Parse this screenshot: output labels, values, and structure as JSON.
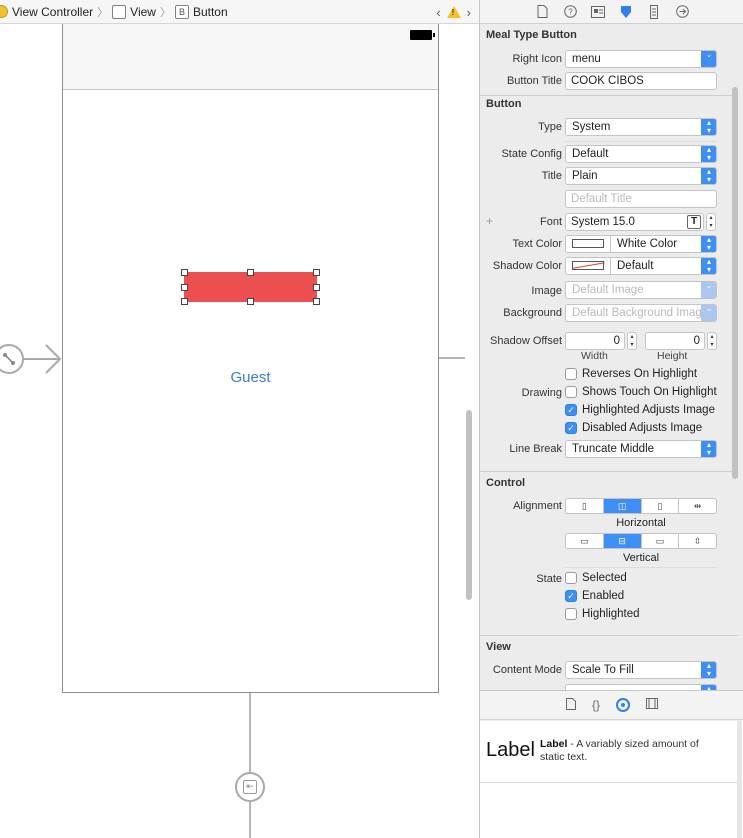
{
  "jumpbar": {
    "items": [
      "View Controller",
      "View",
      "Button"
    ],
    "view_icon": "view-square-icon",
    "button_icon_glyph": "B"
  },
  "canvas": {
    "guest_label": "Guest"
  },
  "inspector": {
    "tabs": [
      "file-icon",
      "help-icon",
      "identity-icon",
      "attributes-icon",
      "size-icon",
      "connections-icon"
    ],
    "active_tab": "attributes-icon",
    "meal_section": {
      "title": "Meal Type Button",
      "right_icon_label": "Right Icon",
      "right_icon_value": "menu",
      "button_title_label": "Button Title",
      "button_title_value": "COOK CIBOS"
    },
    "button_section": {
      "title": "Button",
      "type_label": "Type",
      "type_value": "System",
      "state_config_label": "State Config",
      "state_config_value": "Default",
      "title_label": "Title",
      "title_value": "Plain",
      "default_title_placeholder": "Default Title",
      "font_label": "Font",
      "font_value": "System 15.0",
      "text_color_label": "Text Color",
      "text_color_value": "White Color",
      "shadow_color_label": "Shadow Color",
      "shadow_color_value": "Default",
      "image_label": "Image",
      "image_placeholder": "Default Image",
      "background_label": "Background",
      "background_placeholder": "Default Background Image",
      "shadow_offset_label": "Shadow Offset",
      "shadow_width_value": "0",
      "shadow_height_value": "0",
      "width_caption": "Width",
      "height_caption": "Height",
      "drawing_label": "Drawing",
      "reverses_label": "Reverses On Highlight",
      "reverses_checked": false,
      "shows_touch_label": "Shows Touch On Highlight",
      "shows_touch_checked": false,
      "highlighted_adjusts_label": "Highlighted Adjusts Image",
      "highlighted_adjusts_checked": true,
      "disabled_adjusts_label": "Disabled Adjusts Image",
      "disabled_adjusts_checked": true,
      "line_break_label": "Line Break",
      "line_break_value": "Truncate Middle"
    },
    "control_section": {
      "title": "Control",
      "alignment_label": "Alignment",
      "horizontal_caption": "Horizontal",
      "vertical_caption": "Vertical",
      "horizontal_selected_index": 1,
      "vertical_selected_index": 1,
      "state_label": "State",
      "selected_label": "Selected",
      "selected_checked": false,
      "enabled_label": "Enabled",
      "enabled_checked": true,
      "highlighted_label": "Highlighted",
      "highlighted_checked": false
    },
    "view_section": {
      "title": "View",
      "content_mode_label": "Content Mode",
      "content_mode_value": "Scale To Fill"
    },
    "library": {
      "tabs": [
        "file-icon",
        "braces-icon",
        "object-icon",
        "media-icon"
      ],
      "active_tab": "object-icon",
      "item_big": "Label",
      "item_name": "Label",
      "item_desc": " - A variably sized amount of static text."
    }
  },
  "colors": {
    "accent": "#3d8ef5",
    "button_fill": "#eb4f4f",
    "guest_text": "#3a7ed1"
  }
}
